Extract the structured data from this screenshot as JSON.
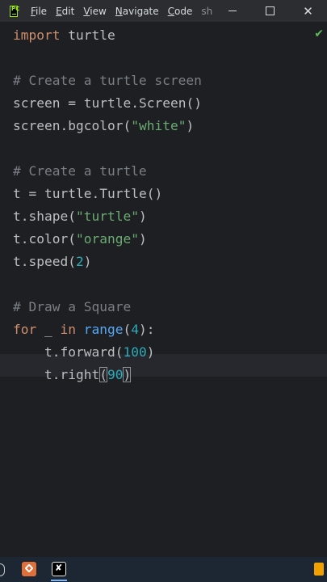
{
  "menu": {
    "items": [
      {
        "mnemonic": "F",
        "rest": "ile"
      },
      {
        "mnemonic": "E",
        "rest": "dit"
      },
      {
        "mnemonic": "V",
        "rest": "iew"
      },
      {
        "mnemonic": "N",
        "rest": "avigate"
      },
      {
        "mnemonic": "C",
        "rest": "ode"
      }
    ],
    "project_label": "shor"
  },
  "window_controls": {
    "minimize_icon": "minimize-icon",
    "maximize_icon": "maximize-icon",
    "close_glyph": "✕"
  },
  "editor": {
    "status_icon": "check-icon",
    "status_glyph": "✔",
    "lines": [
      {
        "t1": "import",
        "t2": " turtle"
      },
      {
        "t1": ""
      },
      {
        "t1": "# Create a turtle screen"
      },
      {
        "t1": "screen",
        "t2": " = ",
        "t3": "turtle",
        "t4": ".",
        "t5": "Screen",
        "t6": "()"
      },
      {
        "t1": "screen",
        "t2": ".",
        "t3": "bgcolor",
        "t4": "(",
        "t5": "\"white\"",
        "t6": ")"
      },
      {
        "t1": ""
      },
      {
        "t1": "# Create a turtle"
      },
      {
        "t1": "t",
        "t2": " = ",
        "t3": "turtle",
        "t4": ".",
        "t5": "Turtle",
        "t6": "()"
      },
      {
        "t1": "t",
        "t2": ".",
        "t3": "shape",
        "t4": "(",
        "t5": "\"turtle\"",
        "t6": ")"
      },
      {
        "t1": "t",
        "t2": ".",
        "t3": "color",
        "t4": "(",
        "t5": "\"orange\"",
        "t6": ")"
      },
      {
        "t1": "t",
        "t2": ".",
        "t3": "speed",
        "t4": "(",
        "t5": "2",
        "t6": ")"
      },
      {
        "t1": ""
      },
      {
        "t1": "# Draw a Square"
      },
      {
        "t1": "for",
        "t2": " _ ",
        "t3": "in",
        "t4": " ",
        "t5": "range",
        "t6": "(",
        "t7": "4",
        "t8": "):"
      },
      {
        "t1": "    ",
        "t2": "t",
        "t3": ".",
        "t4": "forward",
        "t5": "(",
        "t6": "100",
        "t7": ")"
      },
      {
        "t1": "    ",
        "t2": "t",
        "t3": ".",
        "t4": "right",
        "t5": "(",
        "t6": "90",
        "t7": ")"
      }
    ]
  },
  "colors": {
    "keyword": "#cf8e6d",
    "function": "#56a8f5",
    "string": "#6aab73",
    "number": "#2aacb8",
    "comment": "#7a7e85",
    "default": "#bcbec4",
    "background": "#1e1f22"
  },
  "taskbar": {
    "apps": [
      "orange-app-icon",
      "capcut-app-icon"
    ]
  }
}
